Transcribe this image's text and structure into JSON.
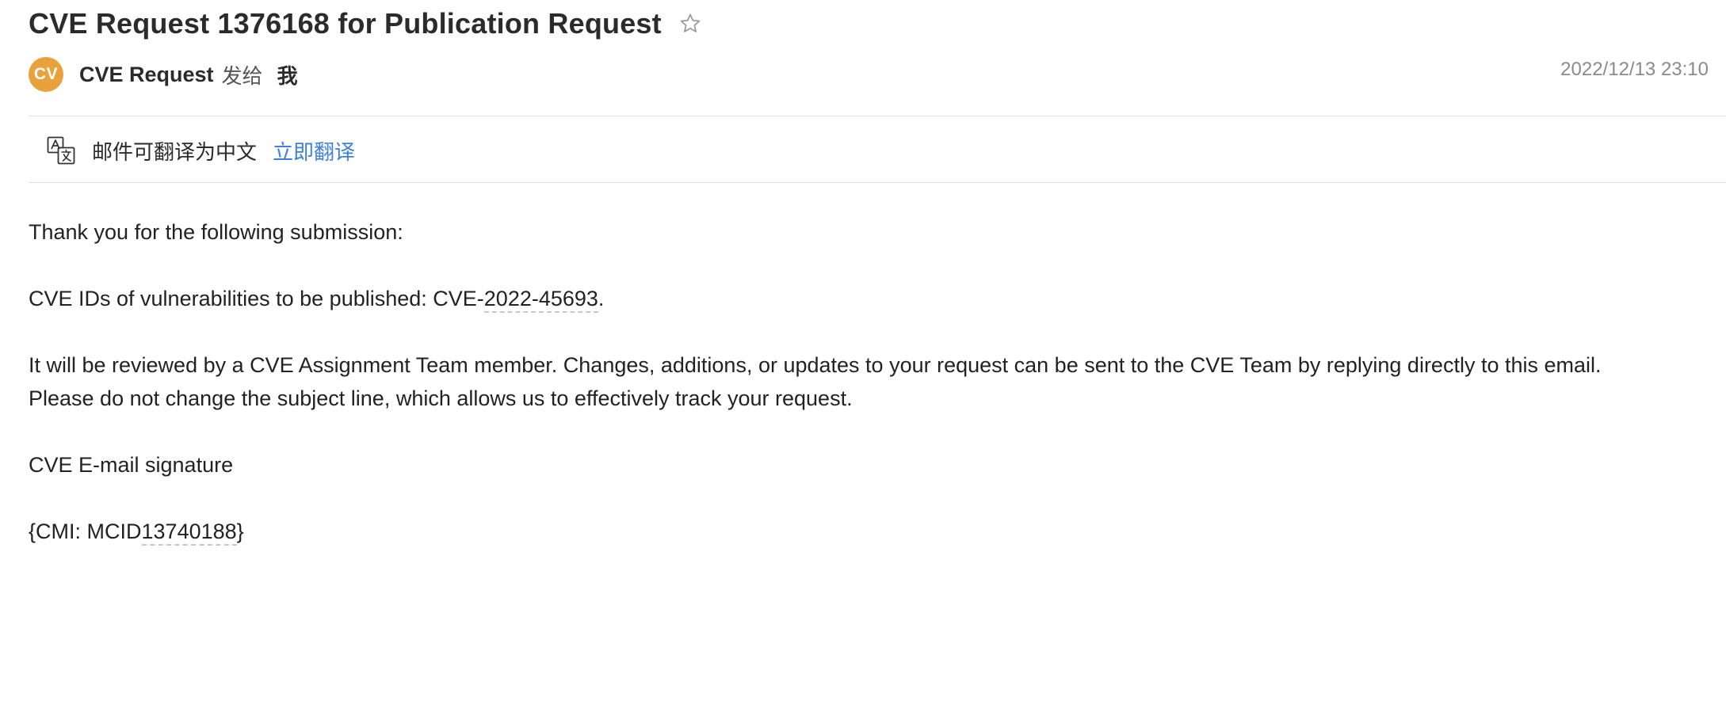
{
  "email": {
    "subject": "CVE Request 1376168 for Publication Request",
    "sender": {
      "avatar_initials": "CV",
      "avatar_color": "#e9a23b",
      "name": "CVE Request",
      "send_to_label": "发给",
      "recipient": "我"
    },
    "date": "2022/12/13 23:10",
    "translate": {
      "notice": "邮件可翻译为中文",
      "action_label": "立即翻译",
      "link_color": "#3d82d8"
    },
    "body": {
      "greeting": "Thank you for the following submission:",
      "cve_prefix": "CVE IDs of vulnerabilities to be published: CVE-",
      "cve_number": "2022-45693",
      "cve_suffix": ".",
      "review_line1": "It will be reviewed by a CVE Assignment Team member. Changes, additions, or updates to your request can be sent to the CVE Team by replying directly to this email.",
      "review_line2": "Please do not change the subject line, which allows us to effectively track your request.",
      "signature": "CVE E-mail signature",
      "cmi_prefix": "{CMI: MCID",
      "cmi_number": "13740188",
      "cmi_suffix": "}"
    }
  },
  "icons": {
    "star": "star-outline-icon",
    "translate": "translate-icon"
  }
}
